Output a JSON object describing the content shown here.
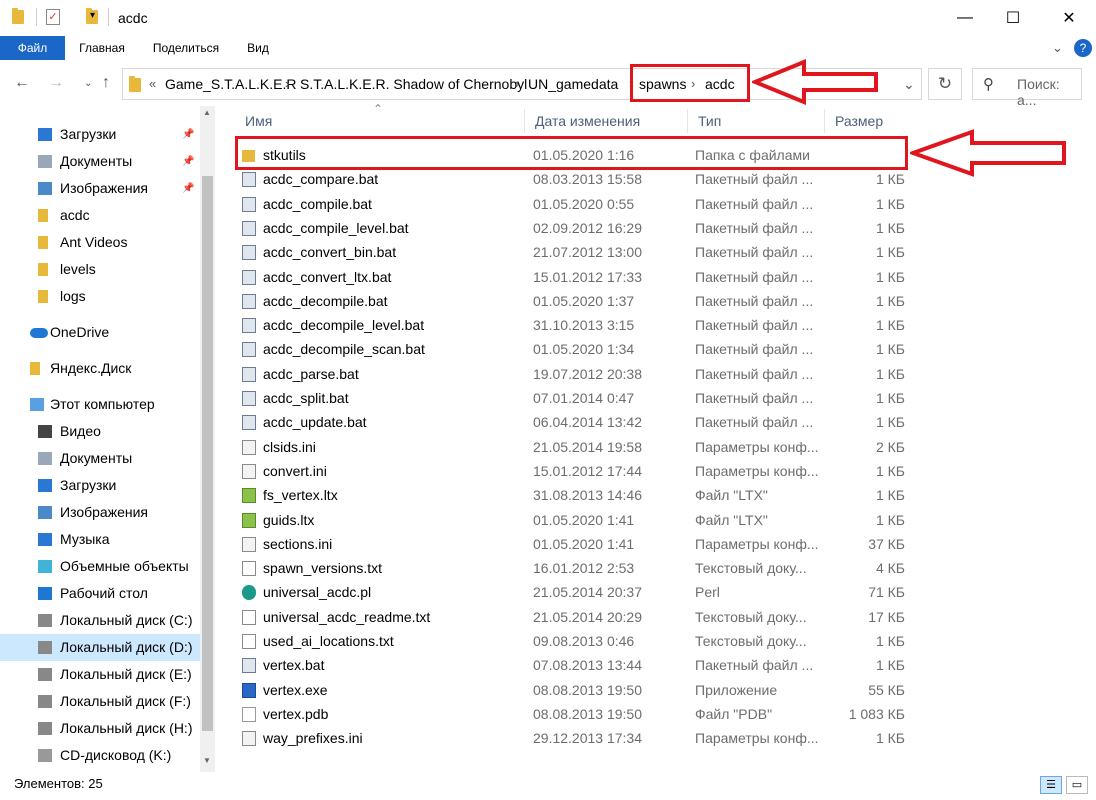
{
  "window": {
    "title": "acdc",
    "minimize": "—",
    "maximize": "☐",
    "close": "✕"
  },
  "ribbon": {
    "tabs": [
      "Файл",
      "Главная",
      "Поделиться",
      "Вид"
    ],
    "help": "?"
  },
  "address": {
    "prefix": "«",
    "crumbs": [
      "Game_S.T.A.L.K.E.R",
      "S.T.A.L.K.E.R. Shadow of Chernobyl",
      "UN_gamedata",
      "spawns",
      "acdc"
    ]
  },
  "search": {
    "placeholder": "Поиск: а..."
  },
  "nav": {
    "items": [
      {
        "label": "Загрузки",
        "icon": "download-icon",
        "pinned": true
      },
      {
        "label": "Документы",
        "icon": "documents-icon",
        "pinned": true
      },
      {
        "label": "Изображения",
        "icon": "pictures-icon",
        "pinned": true
      },
      {
        "label": "acdc",
        "icon": "folder-icon",
        "pinned": false
      },
      {
        "label": "Ant Videos",
        "icon": "folder-icon",
        "pinned": false
      },
      {
        "label": "levels",
        "icon": "folder-icon",
        "pinned": false
      },
      {
        "label": "logs",
        "icon": "folder-icon",
        "pinned": false
      },
      {
        "label": "OneDrive",
        "icon": "cloud-icon",
        "pinned": false
      },
      {
        "label": "Яндекс.Диск",
        "icon": "folder-icon",
        "pinned": false
      },
      {
        "label": "Этот компьютер",
        "icon": "computer-icon",
        "pinned": false
      },
      {
        "label": "Видео",
        "icon": "video-icon",
        "pinned": false
      },
      {
        "label": "Документы",
        "icon": "documents-icon",
        "pinned": false
      },
      {
        "label": "Загрузки",
        "icon": "download-icon",
        "pinned": false
      },
      {
        "label": "Изображения",
        "icon": "pictures-icon",
        "pinned": false
      },
      {
        "label": "Музыка",
        "icon": "music-icon",
        "pinned": false
      },
      {
        "label": "Объемные объекты",
        "icon": "3d-objects-icon",
        "pinned": false
      },
      {
        "label": "Рабочий стол",
        "icon": "desktop-icon",
        "pinned": false
      },
      {
        "label": "Локальный диск (C:)",
        "icon": "drive-icon",
        "pinned": false
      },
      {
        "label": "Локальный диск (D:)",
        "icon": "drive-icon",
        "pinned": false,
        "selected": true
      },
      {
        "label": "Локальный диск (E:)",
        "icon": "drive-icon",
        "pinned": false
      },
      {
        "label": "Локальный диск (F:)",
        "icon": "drive-icon",
        "pinned": false
      },
      {
        "label": "Локальный диск (H:)",
        "icon": "drive-icon",
        "pinned": false
      },
      {
        "label": "CD-дисковод (K:)",
        "icon": "cd-drive-icon",
        "pinned": false
      }
    ]
  },
  "columns": [
    "Имя",
    "Дата изменения",
    "Тип",
    "Размер"
  ],
  "files": [
    {
      "name": "stkutils",
      "date": "01.05.2020 1:16",
      "type": "Папка с файлами",
      "size": "",
      "icon": "folder-icon"
    },
    {
      "name": "acdc_compare.bat",
      "date": "08.03.2013 15:58",
      "type": "Пакетный файл ...",
      "size": "1 КБ",
      "icon": "batch-file-icon"
    },
    {
      "name": "acdc_compile.bat",
      "date": "01.05.2020 0:55",
      "type": "Пакетный файл ...",
      "size": "1 КБ",
      "icon": "batch-file-icon"
    },
    {
      "name": "acdc_compile_level.bat",
      "date": "02.09.2012 16:29",
      "type": "Пакетный файл ...",
      "size": "1 КБ",
      "icon": "batch-file-icon"
    },
    {
      "name": "acdc_convert_bin.bat",
      "date": "21.07.2012 13:00",
      "type": "Пакетный файл ...",
      "size": "1 КБ",
      "icon": "batch-file-icon"
    },
    {
      "name": "acdc_convert_ltx.bat",
      "date": "15.01.2012 17:33",
      "type": "Пакетный файл ...",
      "size": "1 КБ",
      "icon": "batch-file-icon"
    },
    {
      "name": "acdc_decompile.bat",
      "date": "01.05.2020 1:37",
      "type": "Пакетный файл ...",
      "size": "1 КБ",
      "icon": "batch-file-icon"
    },
    {
      "name": "acdc_decompile_level.bat",
      "date": "31.10.2013 3:15",
      "type": "Пакетный файл ...",
      "size": "1 КБ",
      "icon": "batch-file-icon"
    },
    {
      "name": "acdc_decompile_scan.bat",
      "date": "01.05.2020 1:34",
      "type": "Пакетный файл ...",
      "size": "1 КБ",
      "icon": "batch-file-icon"
    },
    {
      "name": "acdc_parse.bat",
      "date": "19.07.2012 20:38",
      "type": "Пакетный файл ...",
      "size": "1 КБ",
      "icon": "batch-file-icon"
    },
    {
      "name": "acdc_split.bat",
      "date": "07.01.2014 0:47",
      "type": "Пакетный файл ...",
      "size": "1 КБ",
      "icon": "batch-file-icon"
    },
    {
      "name": "acdc_update.bat",
      "date": "06.04.2014 13:42",
      "type": "Пакетный файл ...",
      "size": "1 КБ",
      "icon": "batch-file-icon"
    },
    {
      "name": "clsids.ini",
      "date": "21.05.2014 19:58",
      "type": "Параметры конф...",
      "size": "2 КБ",
      "icon": "ini-file-icon"
    },
    {
      "name": "convert.ini",
      "date": "15.01.2012 17:44",
      "type": "Параметры конф...",
      "size": "1 КБ",
      "icon": "ini-file-icon"
    },
    {
      "name": "fs_vertex.ltx",
      "date": "31.08.2013 14:46",
      "type": "Файл \"LTX\"",
      "size": "1 КБ",
      "icon": "ltx-file-icon"
    },
    {
      "name": "guids.ltx",
      "date": "01.05.2020 1:41",
      "type": "Файл \"LTX\"",
      "size": "1 КБ",
      "icon": "ltx-file-icon"
    },
    {
      "name": "sections.ini",
      "date": "01.05.2020 1:41",
      "type": "Параметры конф...",
      "size": "37 КБ",
      "icon": "ini-file-icon"
    },
    {
      "name": "spawn_versions.txt",
      "date": "16.01.2012 2:53",
      "type": "Текстовый доку...",
      "size": "4 КБ",
      "icon": "text-file-icon"
    },
    {
      "name": "universal_acdc.pl",
      "date": "21.05.2014 20:37",
      "type": "Perl",
      "size": "71 КБ",
      "icon": "perl-file-icon"
    },
    {
      "name": "universal_acdc_readme.txt",
      "date": "21.05.2014 20:29",
      "type": "Текстовый доку...",
      "size": "17 КБ",
      "icon": "text-file-icon"
    },
    {
      "name": "used_ai_locations.txt",
      "date": "09.08.2013 0:46",
      "type": "Текстовый доку...",
      "size": "1 КБ",
      "icon": "text-file-icon"
    },
    {
      "name": "vertex.bat",
      "date": "07.08.2013 13:44",
      "type": "Пакетный файл ...",
      "size": "1 КБ",
      "icon": "batch-file-icon"
    },
    {
      "name": "vertex.exe",
      "date": "08.08.2013 19:50",
      "type": "Приложение",
      "size": "55 КБ",
      "icon": "exe-file-icon"
    },
    {
      "name": "vertex.pdb",
      "date": "08.08.2013 19:50",
      "type": "Файл \"PDB\"",
      "size": "1 083 КБ",
      "icon": "blank-file-icon"
    },
    {
      "name": "way_prefixes.ini",
      "date": "29.12.2013 17:34",
      "type": "Параметры конф...",
      "size": "1 КБ",
      "icon": "ini-file-icon"
    }
  ],
  "status": {
    "count": "Элементов: 25"
  },
  "colors": {
    "accent": "#1b67c7",
    "annotation": "#e0151d",
    "selection": "#cce8ff"
  }
}
